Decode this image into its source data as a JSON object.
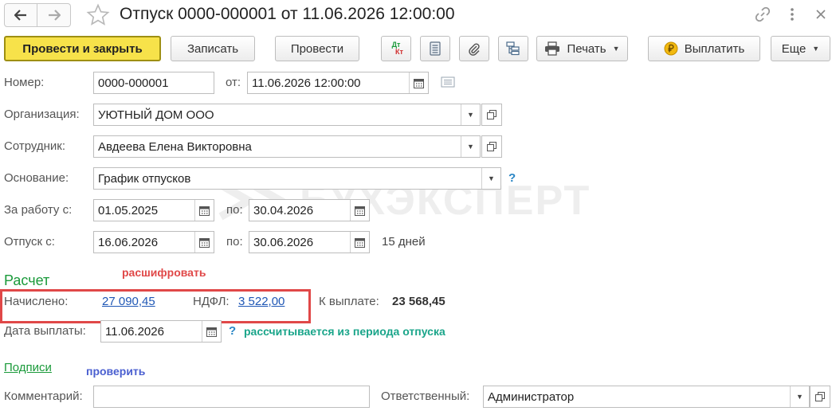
{
  "window": {
    "title": "Отпуск 0000-000001 от 11.06.2026 12:00:00",
    "back_icon": "arrow-left-icon",
    "forward_icon": "arrow-right-icon",
    "favorite_icon": "star-icon",
    "link_icon": "link-icon",
    "menu_icon": "more-vertical-icon",
    "close_icon": "close-icon"
  },
  "toolbar": {
    "post_close": "Провести и закрыть",
    "save": "Записать",
    "post": "Провести",
    "dt_kt_top": "Дт",
    "dt_kt_bottom": "Кт",
    "print": "Печать",
    "pay": "Выплатить",
    "more": "Еще"
  },
  "form": {
    "number_label": "Номер:",
    "number_value": "0000-000001",
    "date_from_label": "от:",
    "date_value": "11.06.2026 12:00:00",
    "org_label": "Организация:",
    "org_value": "УЮТНЫЙ ДОМ ООО",
    "employee_label": "Сотрудник:",
    "employee_value": "Авдеева Елена Викторовна",
    "basis_label": "Основание:",
    "basis_value": "График отпусков",
    "basis_help": "?",
    "work_from_label": "За работу с:",
    "work_from_value": "01.05.2025",
    "work_to_label": "по:",
    "work_to_value": "30.04.2026",
    "vacation_from_label": "Отпуск с:",
    "vacation_from_value": "16.06.2026",
    "vacation_to_label": "по:",
    "vacation_to_value": "30.06.2026",
    "vacation_days": "15 дней"
  },
  "calc": {
    "section_title": "Расчет",
    "annotation_decode": "расшифровать",
    "accrued_label": "Начислено:",
    "accrued_value": "27 090,45",
    "ndfl_label": "НДФЛ:",
    "ndfl_value": "3 522,00",
    "to_pay_label": "К выплате:",
    "to_pay_value": "23 568,45",
    "pay_date_label": "Дата выплаты:",
    "pay_date_value": "11.06.2026",
    "pay_date_help": "?",
    "annotation_period": "рассчитывается из периода отпуска"
  },
  "footer": {
    "signatures_link": "Подписи",
    "annotation_check": "проверить",
    "comment_label": "Комментарий:",
    "comment_value": "",
    "responsible_label": "Ответственный:",
    "responsible_value": "Администратор"
  },
  "watermark": "БУХЭКСПЕРТ",
  "colors": {
    "primary_button": "#f7e24a",
    "section_green": "#1a9a3a",
    "annotation_red": "#e04848",
    "annotation_teal": "#1aa58a",
    "annotation_blue": "#4a5fd0",
    "highlight_border": "#e04848",
    "link": "#1f57b5"
  }
}
